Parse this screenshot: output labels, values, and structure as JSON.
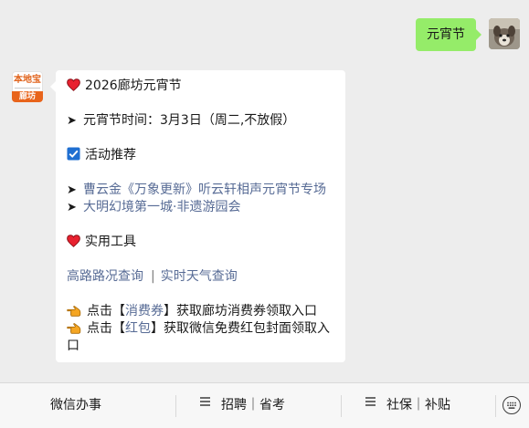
{
  "user_message": {
    "text": "元宵节"
  },
  "account_avatar": {
    "brand_top": "本地宝",
    "brand_bottom": "廊坊"
  },
  "reply": {
    "title": "2026廊坊元宵节",
    "date_line": "元宵节时间：3月3日（周二,不放假）",
    "activity_heading": "活动推荐",
    "activity_links": [
      "曹云金《万象更新》听云轩相声元宵节专场",
      "大明幻境第一城·非遗游园会"
    ],
    "tools_heading": "实用工具",
    "tool_links": [
      "高路路况查询",
      "实时天气查询"
    ],
    "tool_separator": "|",
    "coupon_line": {
      "prefix": "点击【",
      "link": "消费券",
      "suffix": "】获取廊坊消费券领取入口"
    },
    "redpacket_line": {
      "prefix": "点击【",
      "link": "红包",
      "suffix": "】获取微信免费红包封面领取入口"
    },
    "icons": {
      "heart": "red-heart-icon",
      "arrow": "arrow-right-icon",
      "check": "checkbox-icon",
      "pointing": "pointing-hand-icon"
    },
    "arrow_glyph": "➤"
  },
  "menu": {
    "items": [
      "微信办事",
      "招聘｜省考",
      "社保｜补贴"
    ],
    "keyboard_icon": "keyboard-icon"
  },
  "colors": {
    "background": "#ededed",
    "outgoing_bubble": "#95ec69",
    "link": "#576b95",
    "heart": "#e8212f",
    "checkbox": "#1f6fd1",
    "hand": "#f5a623",
    "brand_orange": "#e8641b"
  }
}
